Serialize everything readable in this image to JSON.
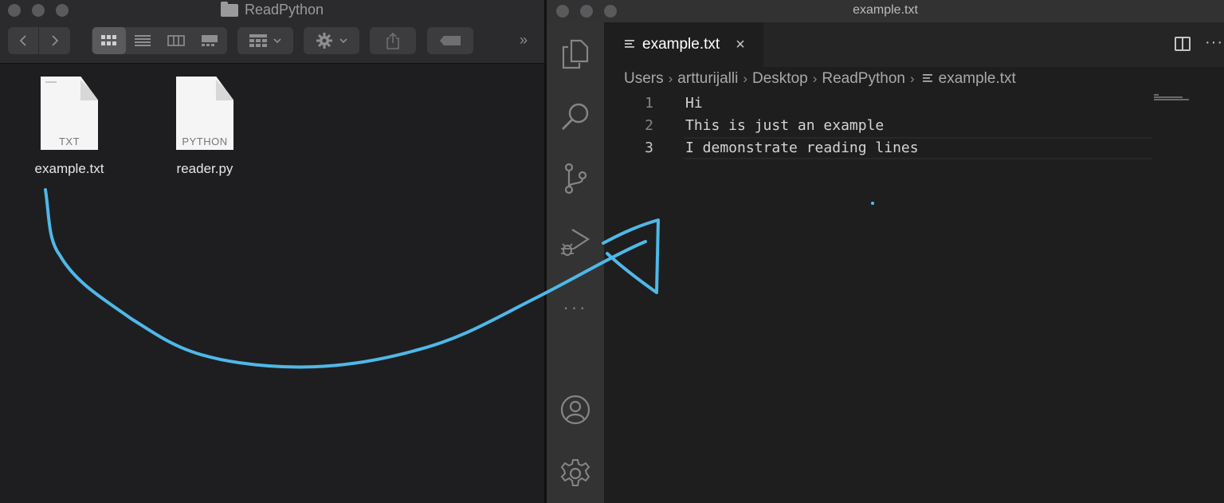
{
  "finder": {
    "title": "ReadPython",
    "overflow_glyph": "»",
    "toolbar": {
      "back_icon": "chevron-left-icon",
      "forward_icon": "chevron-right-icon",
      "views": [
        "icon-view",
        "list-view",
        "column-view",
        "gallery-view"
      ],
      "active_view": "icon-view",
      "group_icon": "group-by-icon",
      "action_icon": "gear-icon",
      "share_icon": "share-icon",
      "tag_icon": "tag-icon"
    },
    "files": [
      {
        "name": "example.txt",
        "type": "TXT"
      },
      {
        "name": "reader.py",
        "type": "PYTHON"
      }
    ]
  },
  "vscode": {
    "window_title": "example.txt",
    "tab": {
      "label": "example.txt",
      "close": "×"
    },
    "breadcrumb": [
      "Users",
      "artturijalli",
      "Desktop",
      "ReadPython",
      "example.txt"
    ],
    "more_actions": "···",
    "lines": [
      {
        "number": "1",
        "text": "Hi"
      },
      {
        "number": "2",
        "text": "This is just an example"
      },
      {
        "number": "3",
        "text": "I demonstrate reading lines"
      }
    ],
    "current_line": 3,
    "activity_icons": [
      "explorer-icon",
      "search-icon",
      "source-control-icon",
      "run-debug-icon",
      "more-icon",
      "account-icon",
      "settings-gear-icon"
    ]
  },
  "colors": {
    "annotation_stroke": "#4fb8e8",
    "finder_bg": "#1e1e20",
    "editor_bg": "#1e1e1e",
    "activity_bar": "#333333"
  }
}
